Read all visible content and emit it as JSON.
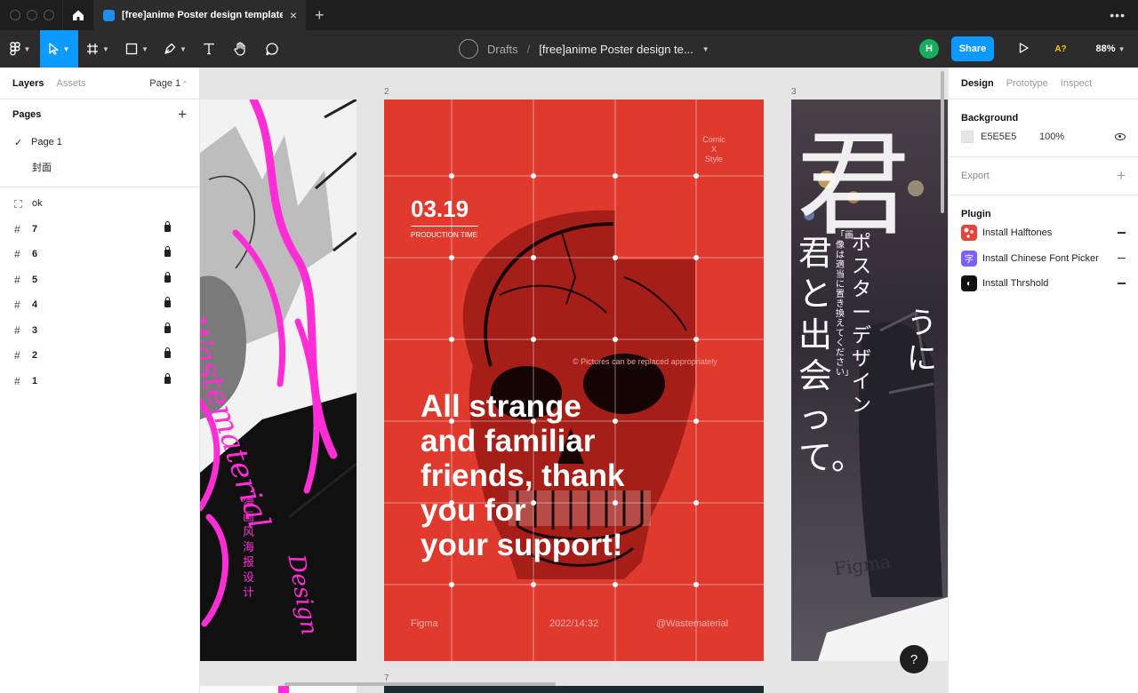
{
  "window": {
    "tab_title": "[free]anime Poster design template ...",
    "new_tab": "+",
    "more": "•••"
  },
  "toolbar": {
    "breadcrumb_root": "Drafts",
    "separator": "/",
    "file_name": "[free]anime Poster design te...",
    "user_initial": "H",
    "share_label": "Share",
    "a11y_label": "A?",
    "zoom_level": "88%"
  },
  "left_panel": {
    "tab_layers": "Layers",
    "tab_assets": "Assets",
    "current_page": "Page 1",
    "pages_title": "Pages",
    "pages": [
      {
        "label": "Page 1",
        "checked": true
      },
      {
        "label": "封面",
        "checked": false
      }
    ],
    "layers": [
      {
        "label": "ok",
        "type": "group",
        "locked": false
      },
      {
        "label": "7",
        "type": "frame",
        "locked": true
      },
      {
        "label": "6",
        "type": "frame",
        "locked": true
      },
      {
        "label": "5",
        "type": "frame",
        "locked": true
      },
      {
        "label": "4",
        "type": "frame",
        "locked": true
      },
      {
        "label": "3",
        "type": "frame",
        "locked": true
      },
      {
        "label": "2",
        "type": "frame",
        "locked": true
      },
      {
        "label": "1",
        "type": "frame",
        "locked": true
      }
    ]
  },
  "canvas": {
    "frame_labels": {
      "f2": "2",
      "f3": "3",
      "f7": "7"
    },
    "poster1": {
      "vertical_text": "Wastematerial",
      "cn_text": "漫画风海报设计",
      "design": "Design"
    },
    "poster2": {
      "date": "03.19",
      "production": "PRODUCTION TIME",
      "comic": "Comic",
      "x": "X",
      "style": "Style",
      "note": "© Pictures can be replaced appropriately",
      "headline_lines": [
        "All strange",
        "and familiar",
        "friends, thank",
        "you for",
        "your support!"
      ],
      "footer_left": "Figma",
      "footer_center": "2022/14:32",
      "footer_right": "@Wastematerial"
    },
    "poster3": {
      "big_kanji": "君",
      "jp_line1": "君と出会って。",
      "jp_line2": "うに",
      "jp_line3": "ポスターデザイン",
      "jp_line4": "「画像は適当に置き換えてください」",
      "figma": "Figma"
    },
    "help": "?"
  },
  "right_panel": {
    "tab_design": "Design",
    "tab_prototype": "Prototype",
    "tab_inspect": "Inspect",
    "background_title": "Background",
    "bg_hex": "E5E5E5",
    "bg_opacity": "100%",
    "export_title": "Export",
    "plugin_title": "Plugin",
    "plugins": [
      {
        "label": "Install Halftones",
        "icon_char": "",
        "color": "#e8423a"
      },
      {
        "label": "Install Chinese Font Picker",
        "icon_char": "字",
        "color": "#7b61ff"
      },
      {
        "label": "Install Thrshold",
        "icon_char": "◐",
        "color": "#111111"
      }
    ]
  },
  "colors": {
    "accent": "#0d99ff",
    "poster_red": "#e03a2f",
    "magenta": "#ff2dd6",
    "canvas_bg": "#e5e5e5"
  }
}
